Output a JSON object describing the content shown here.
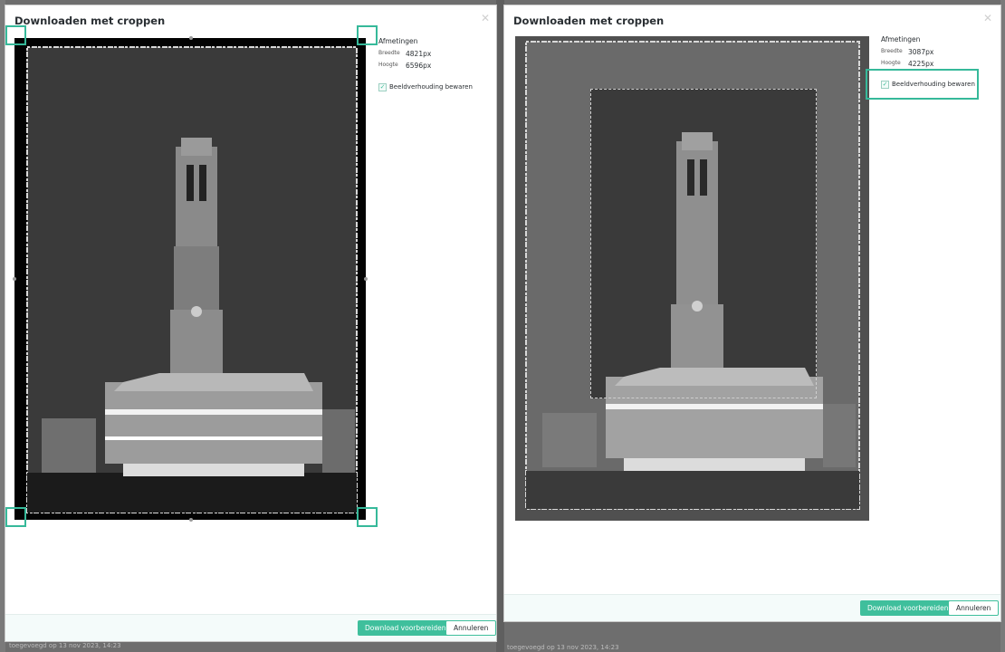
{
  "colors": {
    "accent": "#3fbf9c",
    "highlight": "#36b99a",
    "title": "#2a2f33"
  },
  "left_dialog": {
    "title": "Downloaden met croppen",
    "close_icon": "close-icon",
    "dimensions_heading": "Afmetingen",
    "width_label": "Breedte",
    "width_value": "4821px",
    "height_label": "Hoogte",
    "height_value": "6596px",
    "keep_ratio_label": "Beeldverhouding bewaren",
    "keep_ratio_checked": true,
    "primary_button": "Download voorbereiden",
    "cancel_button": "Annuleren"
  },
  "right_dialog": {
    "title": "Downloaden met croppen",
    "close_icon": "close-icon",
    "dimensions_heading": "Afmetingen",
    "width_label": "Breedte",
    "width_value": "3087px",
    "height_label": "Hoogte",
    "height_value": "4225px",
    "keep_ratio_label": "Beeldverhouding bewaren",
    "keep_ratio_checked": true,
    "primary_button": "Download voorbereiden",
    "cancel_button": "Annuleren"
  },
  "backdrop": {
    "footer_text_left": "toegevoegd op 13 nov 2023, 14:23",
    "footer_text_right": "toegevoegd op 13 nov 2023, 14:23"
  }
}
